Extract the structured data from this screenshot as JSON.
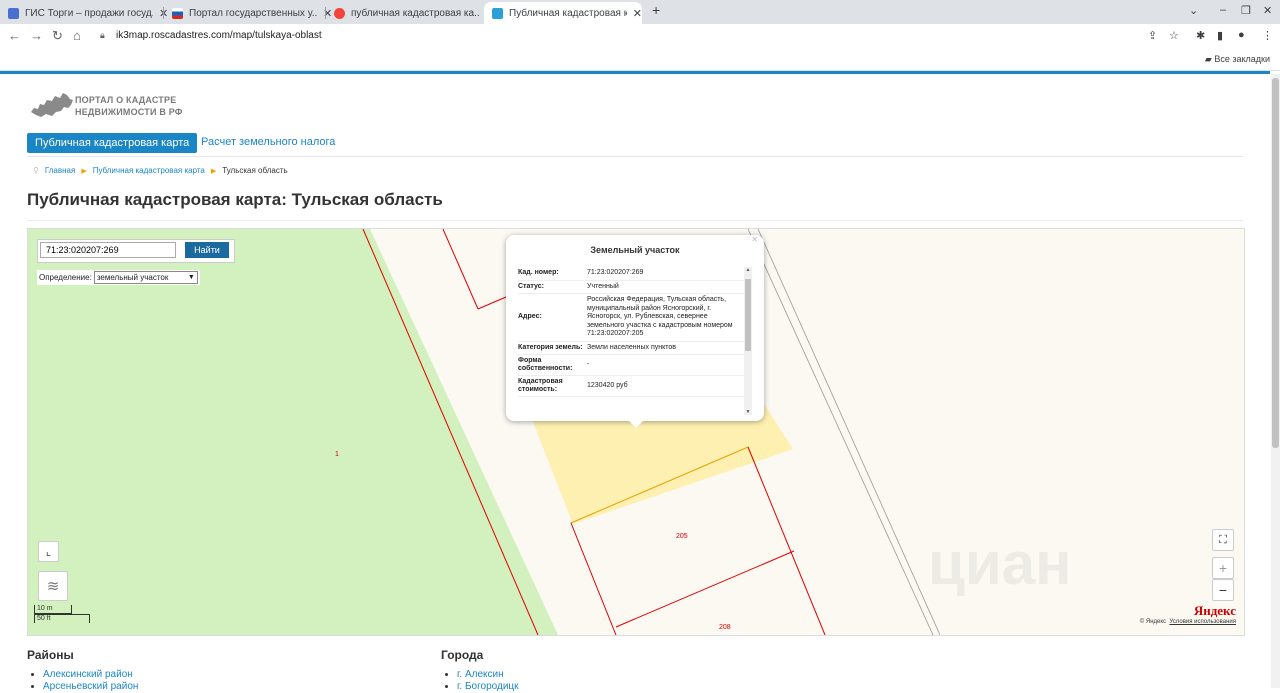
{
  "browser": {
    "tabs": [
      {
        "title": "ГИС Торги – продажи госуд...",
        "favicon_color": "#4a6fd0",
        "active": false
      },
      {
        "title": "Портал государственных у...",
        "favicon_color": "#1b5fb8",
        "active": false
      },
      {
        "title": "публичная кадастровая ка...",
        "favicon_color": "#f2443a",
        "active": false
      },
      {
        "title": "Публичная кадастровая ка...",
        "favicon_color": "#2ba0d8",
        "active": true
      }
    ],
    "url": "ik3map.roscadastres.com/map/tulskaya-oblast",
    "bookmarks_label": "Все закладки"
  },
  "site": {
    "logo_line1": "ПОРТАЛ О КАДАСТРЕ",
    "logo_line2": "НЕДВИЖИМОСТИ В РФ",
    "menu_active": "Публичная кадастровая карта",
    "menu_link": "Расчет земельного налога",
    "breadcrumbs": [
      "Главная",
      "Публичная кадастровая карта",
      "Тульская область"
    ],
    "page_title": "Публичная кадастровая карта: Тульская область"
  },
  "map": {
    "search_value": "71:23:020207:269",
    "search_button": "Найти",
    "definition_label": "Определение:",
    "definition_value": "земельный участок",
    "parcel_labels": [
      "1",
      "205",
      "208"
    ],
    "scale_m": "10 m",
    "scale_ft": "50 ft",
    "yandex_logo": "Яндекс",
    "copyright": "© Яндекс",
    "terms": "Условия использования",
    "watermark": "циан"
  },
  "popup": {
    "title": "Земельный участок",
    "rows": [
      {
        "key": "Кад. номер:",
        "value": "71:23:020207:269"
      },
      {
        "key": "Статус:",
        "value": "Учтенный"
      },
      {
        "key": "Адрес:",
        "value": "Российская Федерация, Тульская область, муниципальный район Ясногорский, г. Ясногорск, ул. Рублевская, севернее земельного участка с кадастровым номером 71:23:020207:205"
      },
      {
        "key": "Категория земель:",
        "value": "Земли населенных пунктов"
      },
      {
        "key": "Форма собственности:",
        "value": "-"
      },
      {
        "key": "Кадастровая стоимость:",
        "value": "1230420 руб"
      }
    ]
  },
  "footer": {
    "districts_title": "Районы",
    "districts": [
      "Алексинский район",
      "Арсеньевский район"
    ],
    "cities_title": "Города",
    "cities": [
      "г. Алексин",
      "г. Богородицк"
    ]
  }
}
